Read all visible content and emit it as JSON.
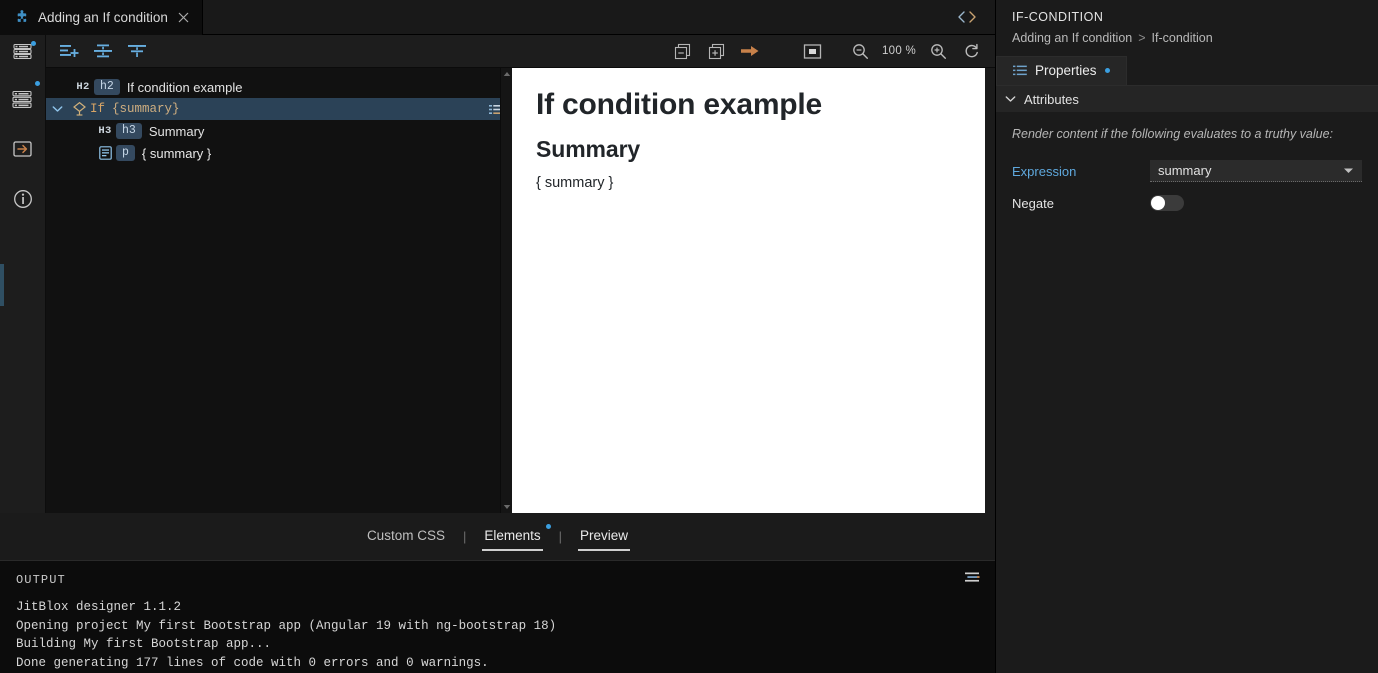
{
  "tab": {
    "icon": "puzzle-icon",
    "label": "Adding an If condition",
    "close": "×"
  },
  "toolbar": {
    "layers_icon": "layers-panel-icon",
    "add_element_icon": "add-element-icon",
    "insert_between_icon": "insert-between-icon",
    "insert_below_icon": "insert-below-icon",
    "collapse_icon": "collapse-all-icon",
    "expand_icon": "expand-all-icon",
    "next_icon": "go-to-next-icon",
    "viewport_icon": "viewport-device-icon",
    "zoom_out_icon": "zoom-out-icon",
    "zoom_level": "100 %",
    "zoom_in_icon": "zoom-in-icon",
    "refresh_icon": "refresh-icon",
    "code_toggle_icon": "code-brackets-icon"
  },
  "rail": {
    "items": [
      {
        "icon": "layers-icon",
        "name": "layers"
      },
      {
        "icon": "import-arrow-icon",
        "name": "import"
      },
      {
        "icon": "info-circle-icon",
        "name": "info"
      }
    ]
  },
  "tree": {
    "rows": [
      {
        "kind": "H2",
        "badge": "h2",
        "label": "If condition example",
        "indent": 1,
        "selected": false,
        "mono": false
      },
      {
        "kind": "",
        "badge": "",
        "label": "If",
        "extra": "{summary}",
        "indent": 0,
        "selected": true,
        "mono": true
      },
      {
        "kind": "H3",
        "badge": "h3",
        "label": "Summary",
        "indent": 2,
        "selected": false,
        "mono": false
      },
      {
        "kind": "",
        "badge": "p",
        "label": "{ summary }",
        "indent": 2,
        "selected": false,
        "mono": false
      }
    ],
    "row_menu_icon": "row-options-icon",
    "twisty_icon": "chevron-down-icon",
    "if_icon": "if-condition-diamond-icon",
    "paragraph_icon": "paragraph-icon",
    "scroll_up_icon": "scroll-up-arrow",
    "scroll_down_icon": "scroll-down-arrow"
  },
  "preview": {
    "heading": "If condition example",
    "subheading": "Summary",
    "paragraph": "{ summary }"
  },
  "bottom_tabs": {
    "items": [
      {
        "label": "Custom CSS",
        "active": false,
        "dot": false
      },
      {
        "label": "Elements",
        "active": true,
        "dot": true
      },
      {
        "label": "Preview",
        "active": true,
        "dot": false
      }
    ],
    "separator": "|"
  },
  "output": {
    "title": "OUTPUT",
    "menu_icon": "output-options-icon",
    "lines": [
      "JitBlox designer 1.1.2",
      "Opening project My first Bootstrap app (Angular 19 with ng-bootstrap 18)",
      "Building My first Bootstrap app...",
      "Done generating 177 lines of code with 0 errors and 0 warnings."
    ]
  },
  "inspector": {
    "title": "IF-CONDITION",
    "breadcrumb": {
      "root": "Adding an If condition",
      "separator": ">",
      "current": "If-condition"
    },
    "tab": {
      "icon": "properties-list-icon",
      "label": "Properties",
      "dot": true
    },
    "section": {
      "label": "Attributes",
      "chevron": "chevron-down-icon"
    },
    "hint": "Render content if the following evaluates to a truthy value:",
    "fields": [
      {
        "label": "Expression",
        "type": "select",
        "value": "summary",
        "caret": "caret-down-icon"
      },
      {
        "label": "Negate",
        "type": "toggle",
        "value": "off"
      }
    ]
  },
  "colors": {
    "accent_blue": "#3b9fe0",
    "selection": "#2b4257",
    "badge_bg": "#34495f",
    "mono_orange": "#d9a566",
    "link_blue": "#5fa8dd"
  }
}
